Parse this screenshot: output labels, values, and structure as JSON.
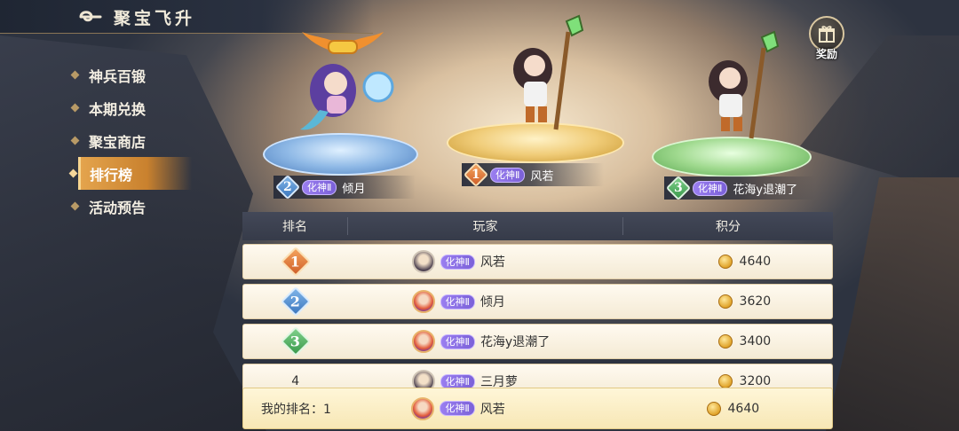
{
  "header": {
    "title": "聚宝飞升"
  },
  "sidebar": {
    "items": [
      {
        "label": "神兵百锻",
        "active": false
      },
      {
        "label": "本期兑换",
        "active": false
      },
      {
        "label": "聚宝商店",
        "active": false
      },
      {
        "label": "排行榜",
        "active": true
      },
      {
        "label": "活动预告",
        "active": false
      }
    ]
  },
  "reward": {
    "label": "奖励"
  },
  "podium": {
    "first": {
      "rank": "1",
      "badge": "化神Ⅱ",
      "name": "风若"
    },
    "second": {
      "rank": "2",
      "badge": "化神Ⅱ",
      "name": "倾月"
    },
    "third": {
      "rank": "3",
      "badge": "化神Ⅱ",
      "name": "花海y退潮了"
    }
  },
  "table": {
    "headers": {
      "rank": "排名",
      "player": "玩家",
      "score": "积分"
    },
    "rows": [
      {
        "rank": "1",
        "badge": "化神Ⅱ",
        "name": "风若",
        "score": "4640"
      },
      {
        "rank": "2",
        "badge": "化神Ⅱ",
        "name": "倾月",
        "score": "3620"
      },
      {
        "rank": "3",
        "badge": "化神Ⅱ",
        "name": "花海y退潮了",
        "score": "3400"
      },
      {
        "rank": "4",
        "badge": "化神Ⅱ",
        "name": "三月萝",
        "score": "3200"
      }
    ]
  },
  "my_rank": {
    "label": "我的排名：1",
    "badge": "化神Ⅱ",
    "name": "风若",
    "score": "4640"
  },
  "colors": {
    "accent": "#e4a44d",
    "badge": "#9a7ef0",
    "rank1": "#d0602a",
    "rank2": "#3d78bf",
    "rank3": "#3a9a4c"
  }
}
